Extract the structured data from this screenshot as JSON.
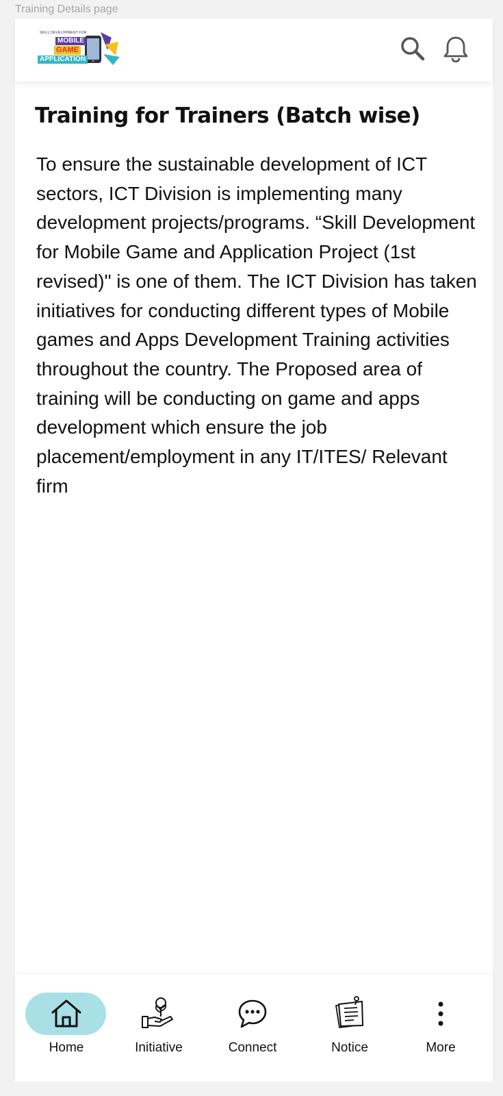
{
  "frame_label": "Training Details page",
  "header": {
    "logo": {
      "tagline": "SKILL DEVELOPMENT FOR",
      "word1": "MOBILE",
      "word2": "GAME",
      "word3": "APPLICATION",
      "colors": {
        "purple": "#5b3fa0",
        "yellow": "#f4c21b",
        "red": "#d9302c",
        "teal": "#34b7c4"
      }
    },
    "icons": [
      "search-icon",
      "bell-icon"
    ]
  },
  "content": {
    "title": "Training for Trainers (Batch wise)",
    "body": "To ensure the sustainable development of ICT sectors, ICT Division is implementing many development projects/programs. “Skill Development for Mobile Game and Application Project (1st revised)\" is one of them. The ICT Division has taken initiatives for conducting different types of Mobile games and Apps Development Training activities throughout the country. The Proposed area of training will be conducting on game and apps development which ensure the job placement/employment in any IT/ITES/ Relevant firm"
  },
  "bottom_nav": {
    "active_color": "#a8e0e6",
    "items": [
      {
        "label": "Home",
        "icon": "home-icon",
        "active": true
      },
      {
        "label": "Initiative",
        "icon": "initiative-icon",
        "active": false
      },
      {
        "label": "Connect",
        "icon": "chat-icon",
        "active": false
      },
      {
        "label": "Notice",
        "icon": "notice-icon",
        "active": false
      },
      {
        "label": "More",
        "icon": "more-vertical-icon",
        "active": false
      }
    ]
  }
}
